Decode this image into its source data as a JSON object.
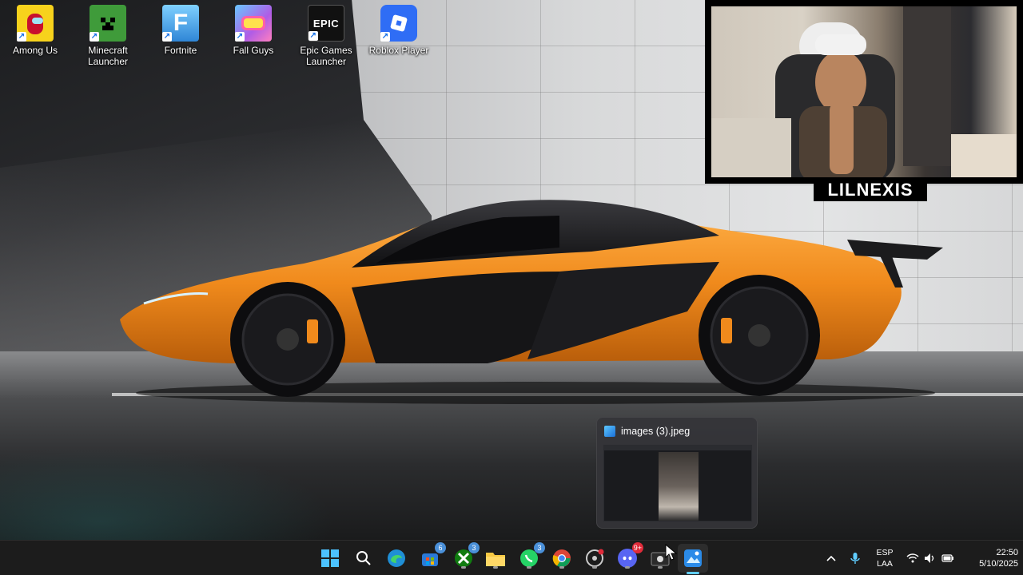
{
  "desktop": {
    "icons": [
      {
        "label": "Among Us",
        "icon": "among-us-icon",
        "color": "#c8102e"
      },
      {
        "label": "Minecraft Launcher",
        "icon": "minecraft-icon",
        "color": "#2e7d32"
      },
      {
        "label": "Fortnite",
        "icon": "fortnite-icon",
        "color": "#4fa3e3",
        "glyph": "F"
      },
      {
        "label": "Fall Guys",
        "icon": "fall-guys-icon",
        "color": "#a15ce0"
      },
      {
        "label": "Epic Games Launcher",
        "icon": "epic-games-icon",
        "color": "#111111",
        "glyph": "EPIC"
      },
      {
        "label": "Roblox Player",
        "icon": "roblox-icon",
        "color": "#1f6ff2"
      }
    ]
  },
  "webcam": {
    "name": "LILNEXIS"
  },
  "preview": {
    "title": "images (3).jpeg",
    "icon": "photos-app-icon"
  },
  "taskbar": {
    "apps": [
      {
        "name": "start",
        "icon": "windows-start-icon"
      },
      {
        "name": "search",
        "icon": "search-icon"
      },
      {
        "name": "edge",
        "icon": "edge-icon"
      },
      {
        "name": "store",
        "icon": "store-icon",
        "badge": "6"
      },
      {
        "name": "xbox",
        "icon": "xbox-icon",
        "badge": "3"
      },
      {
        "name": "explorer",
        "icon": "folder-icon"
      },
      {
        "name": "whatsapp",
        "icon": "whatsapp-icon",
        "badge": "3"
      },
      {
        "name": "chrome",
        "icon": "chrome-icon"
      },
      {
        "name": "recorder",
        "icon": "screen-recorder-icon"
      },
      {
        "name": "discord",
        "icon": "discord-icon",
        "badge": "9+"
      },
      {
        "name": "capture",
        "icon": "capture-icon"
      },
      {
        "name": "photos",
        "icon": "photos-icon"
      }
    ],
    "language": {
      "line1": "ESP",
      "line2": "LAA"
    },
    "clock": {
      "time": "22:50",
      "date": "5/10/2025"
    }
  },
  "colors": {
    "taskbar": "#1c1c1c",
    "accent": "#60cdff",
    "car_orange": "#f08a1c"
  }
}
